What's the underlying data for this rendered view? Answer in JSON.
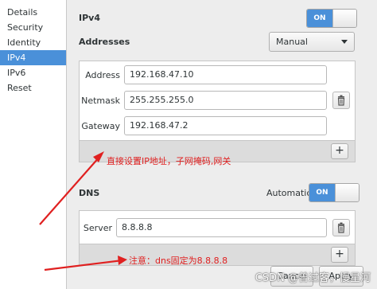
{
  "sidebar": {
    "items": [
      {
        "label": "Details"
      },
      {
        "label": "Security"
      },
      {
        "label": "Identity"
      },
      {
        "label": "IPv4"
      },
      {
        "label": "IPv6"
      },
      {
        "label": "Reset"
      }
    ],
    "active_item": "IPv4"
  },
  "ipv4": {
    "title": "IPv4",
    "toggle_label": "ON",
    "enabled": true
  },
  "addresses": {
    "heading": "Addresses",
    "method": "Manual",
    "address_label": "Address",
    "address_value": "192.168.47.10",
    "netmask_label": "Netmask",
    "netmask_value": "255.255.255.0",
    "gateway_label": "Gateway",
    "gateway_value": "192.168.47.2",
    "add_label": "+"
  },
  "dns": {
    "heading": "DNS",
    "automatic_label": "Automatic",
    "toggle_label": "ON",
    "automatic_enabled": true,
    "server_label": "Server",
    "server_value": "8.8.8.8",
    "add_label": "+"
  },
  "buttons": {
    "cancel": "Cancel",
    "apply": "Apply"
  },
  "annotations": {
    "address_note": "直接设置IP地址，子网掩码,网关",
    "dns_note": "注意：dns固定为8.8.8.8",
    "color": "#e02020"
  },
  "watermark": "CSDN @曾过客，慢星河",
  "colors": {
    "accent": "#4a90d9",
    "annotation": "#e02020"
  }
}
